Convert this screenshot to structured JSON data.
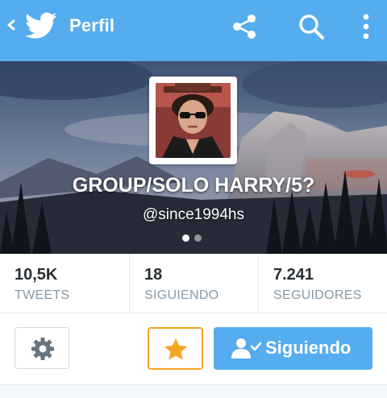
{
  "app": {
    "title": "Perfil",
    "accent_color": "#55acee"
  },
  "actionbar": {
    "icons": [
      "chevron-left-icon",
      "twitter-bird-icon",
      "share-icon",
      "search-icon",
      "overflow-menu-icon"
    ]
  },
  "profile": {
    "display_name": "GROUP/SOLO HARRY/5?",
    "handle": "@since1994hs",
    "pager": {
      "pages": 2,
      "active_index": 0
    }
  },
  "stats": [
    {
      "value": "10,5K",
      "label": "TWEETS"
    },
    {
      "value": "18",
      "label": "SIGUIENDO"
    },
    {
      "value": "7.241",
      "label": "SEGUIDORES"
    }
  ],
  "actions": {
    "settings_icon": "gear-icon",
    "favorite_icon": "star-icon",
    "favorite_color": "#f5a623",
    "follow_label": "Siguiendo",
    "follow_icon": "user-check-icon"
  }
}
